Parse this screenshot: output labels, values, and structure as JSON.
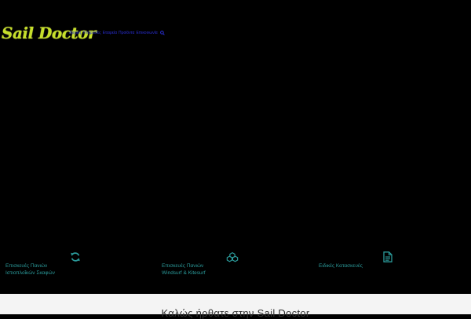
{
  "header": {
    "logo_text": "Sail Doctor",
    "nav": [
      "Αρχική",
      "Υπηρεσίες",
      "Εταιρεία",
      "Προϊόντα",
      "Επικοινωνία"
    ]
  },
  "services": [
    {
      "label_line1": "Επισκευές Πανιών",
      "label_line2": "Ιστιοπλοΐκών Σκαφών",
      "icon": "refresh-icon"
    },
    {
      "label_line1": "Επισκευές Πανιών",
      "label_line2": "Windsurf & Kitesurf",
      "icon": "boxes-icon"
    },
    {
      "label_line1": "Ειδικές Κατασκευές",
      "label_line2": "",
      "icon": "document-icon"
    }
  ],
  "welcome": {
    "title": "Καλώς ήρθατε στην Sail Doctor"
  },
  "colors": {
    "accent": "#c6df2a",
    "teal": "#2b9b9b",
    "nav_link": "#2a2fd6",
    "band": "#f4f4f4"
  }
}
